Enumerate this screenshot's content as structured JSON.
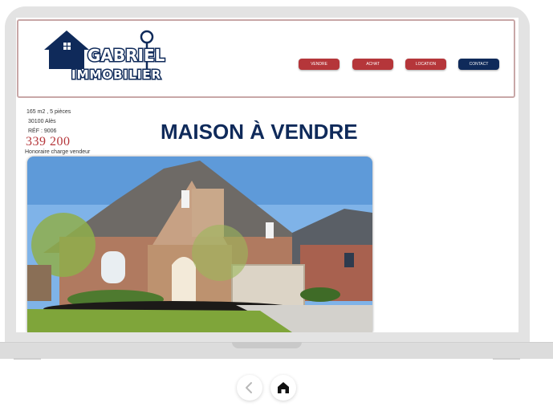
{
  "logo": {
    "line1": "GABRIEL",
    "line2": "IMMOBILIER"
  },
  "nav": [
    {
      "label": "VENDRE"
    },
    {
      "label": "ACHAT"
    },
    {
      "label": "LOCATION"
    },
    {
      "label": "CONTACT"
    }
  ],
  "listing": {
    "surface_rooms": "165 m2 , 5 pièces",
    "location": "30100 Alès",
    "reference": "RÉF : 9006",
    "price": "339 200",
    "fees": "Honoraire charge vendeur",
    "title": "MAISON À VENDRE"
  },
  "colors": {
    "accent_red": "#b5363a",
    "brand_navy": "#0f2a5a"
  },
  "icons": {
    "back": "chevron-left-icon",
    "home": "home-icon"
  }
}
